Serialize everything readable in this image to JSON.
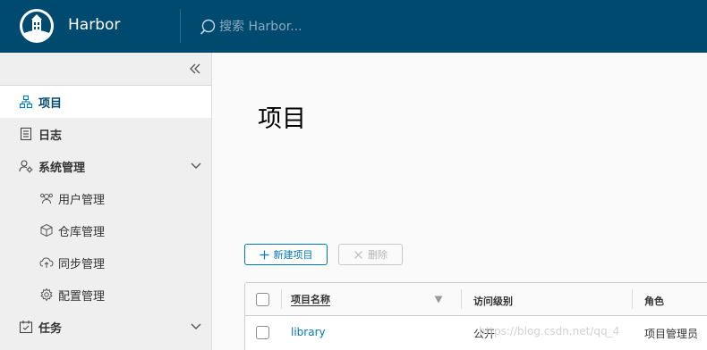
{
  "header": {
    "app_title": "Harbor",
    "search_placeholder": "搜索 Harbor...",
    "background_color": "#004a70"
  },
  "sidebar": {
    "collapse_icon": "double-chevron-left-icon",
    "items": [
      {
        "label": "项目",
        "icon": "project-icon",
        "active": true
      },
      {
        "label": "日志",
        "icon": "log-icon"
      },
      {
        "label": "系统管理",
        "icon": "admin-icon",
        "expanded": true
      },
      {
        "label": "用户管理",
        "icon": "users-icon",
        "sub": true
      },
      {
        "label": "仓库管理",
        "icon": "registry-icon",
        "sub": true
      },
      {
        "label": "同步管理",
        "icon": "replication-icon",
        "sub": true
      },
      {
        "label": "配置管理",
        "icon": "settings-icon",
        "sub": true
      },
      {
        "label": "任务",
        "icon": "tasks-icon"
      }
    ]
  },
  "main": {
    "page_title": "项目",
    "new_project_label": "新建项目",
    "delete_label": "删除",
    "table": {
      "headers": [
        "项目名称",
        "访问级别",
        "角色"
      ],
      "rows": [
        {
          "name": "library",
          "access": "公开",
          "role": "项目管理员"
        }
      ]
    }
  },
  "watermark": "https://blog.csdn.net/qq_4",
  "accent_color": "#0079b8"
}
